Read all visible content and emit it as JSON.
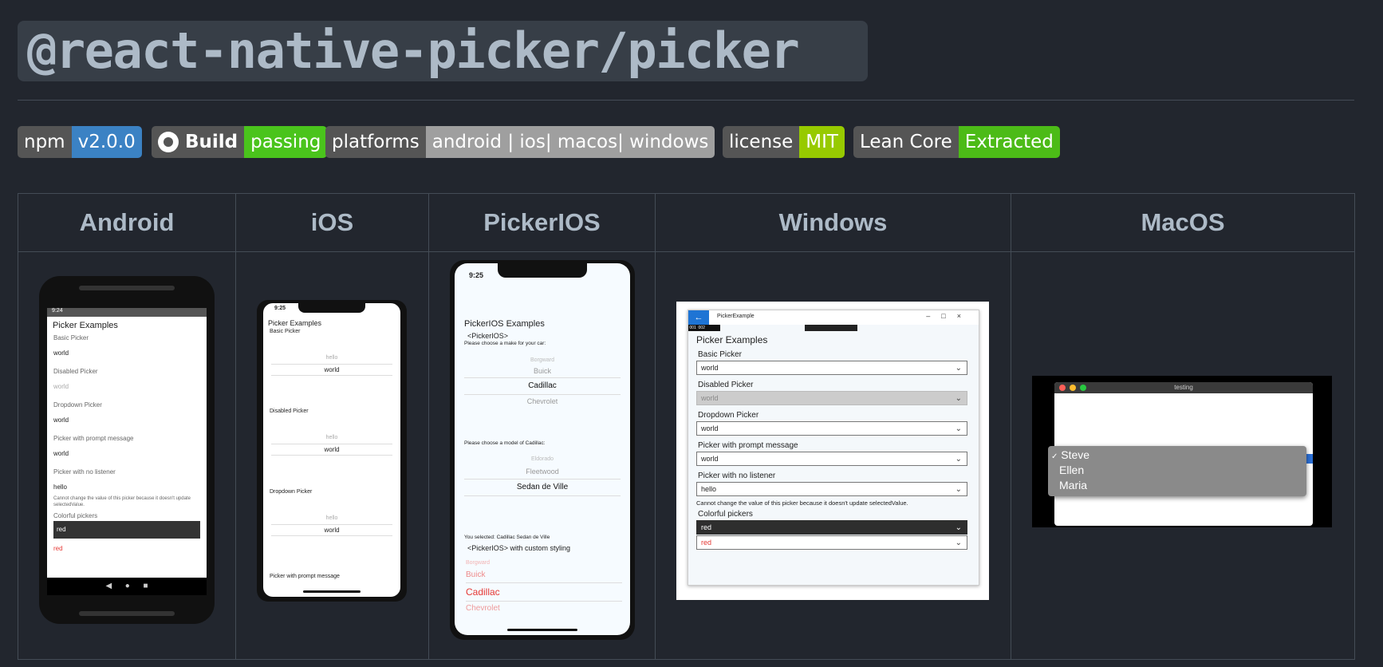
{
  "title": "@react-native-picker/picker",
  "badges": [
    {
      "left": "npm",
      "right": "v2.0.0",
      "color": "#3b82c4"
    },
    {
      "left": "Build",
      "right": "passing",
      "color": "#4ac41c",
      "icon": "github-icon"
    },
    {
      "left": "platforms",
      "right": "android | ios| macos| windows",
      "color": "#9f9f9f"
    },
    {
      "left": "license",
      "right": "MIT",
      "color": "#97ca00"
    },
    {
      "left": "Lean Core",
      "right": "Extracted",
      "color": "#4cbb17"
    }
  ],
  "table": {
    "headers": [
      "Android",
      "iOS",
      "PickerIOS",
      "Windows",
      "MacOS"
    ]
  },
  "android": {
    "time": "9:24",
    "heading": "Picker Examples",
    "sections": [
      {
        "label": "Basic Picker",
        "value": "world"
      },
      {
        "label": "Disabled Picker",
        "value": "world"
      },
      {
        "label": "Dropdown Picker",
        "value": "world"
      },
      {
        "label": "Picker with prompt message",
        "value": "world"
      },
      {
        "label": "Picker with no listener",
        "value": "hello"
      }
    ],
    "note": "Cannot change the value of this picker because it doesn't update selectedValue.",
    "colorful_label": "Colorful pickers",
    "colorful_dark": "red",
    "colorful_light": "red"
  },
  "ios": {
    "time": "9:25",
    "heading": "Picker Examples",
    "sections": [
      {
        "label": "Basic Picker",
        "above": "hello",
        "value": "world"
      },
      {
        "label": "Disabled Picker",
        "above": "hello",
        "value": "world"
      },
      {
        "label": "Dropdown Picker",
        "above": "hello",
        "value": "world"
      }
    ],
    "last_label": "Picker with prompt message"
  },
  "pickerios": {
    "time": "9:25",
    "heading": "PickerIOS Examples",
    "sub1": "<PickerIOS>",
    "make_prompt": "Please choose a make for your car:",
    "makes": [
      "Borgward",
      "Buick",
      "Cadillac",
      "Chevrolet"
    ],
    "model_prompt": "Please choose a model of Cadillac:",
    "models": [
      "Eldorado",
      "Fleetwood",
      "Sedan de Ville"
    ],
    "selected": "You selected: Cadillac Sedan de Ville",
    "sub2": "<PickerIOS> with custom styling",
    "styled": [
      "Borgward",
      "Buick",
      "Cadillac",
      "Chevrolet"
    ]
  },
  "windows": {
    "app_title": "PickerExample",
    "counters": [
      "001",
      "002"
    ],
    "heading": "Picker Examples",
    "sections": [
      {
        "label": "Basic Picker",
        "value": "world"
      },
      {
        "label": "Disabled Picker",
        "value": "world"
      },
      {
        "label": "Dropdown Picker",
        "value": "world"
      },
      {
        "label": "Picker with prompt message",
        "value": "world"
      },
      {
        "label": "Picker with no listener",
        "value": "hello"
      }
    ],
    "note": "Cannot change the value of this picker because it doesn't update selectedValue.",
    "colorful_label": "Colorful pickers",
    "colorful_dark": "red",
    "colorful_light": "red"
  },
  "macos": {
    "window_title": "testing",
    "checkmark": "✓",
    "options": [
      "Steve",
      "Ellen",
      "Maria"
    ]
  }
}
